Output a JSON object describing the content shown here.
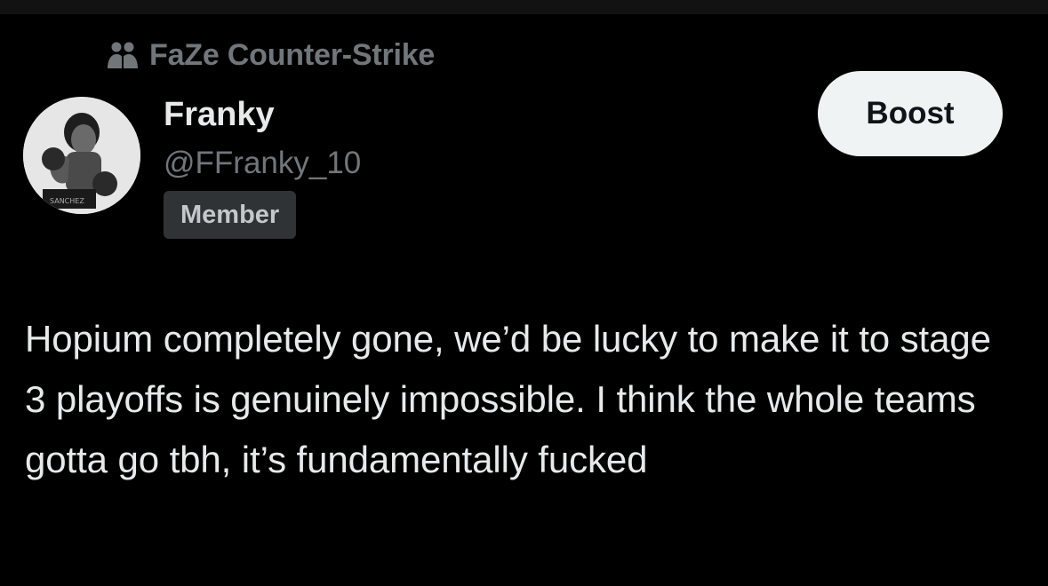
{
  "community": {
    "icon": "people-icon",
    "name": "FaZe Counter-Strike"
  },
  "author": {
    "display_name": "Franky",
    "handle": "@FFranky_10",
    "badge": "Member",
    "avatar_alt": "boxer-avatar"
  },
  "actions": {
    "boost_label": "Boost"
  },
  "post": {
    "text": "Hopium completely gone, we’d be lucky to make it to stage 3 playoffs is genuinely impossible. I think the whole teams gotta go tbh, it’s fundamentally fucked"
  },
  "colors": {
    "background": "#000000",
    "primary_text": "#e7e9ea",
    "secondary_text": "#71767b",
    "badge_bg": "#2f3336",
    "button_bg": "#eff3f4",
    "button_text": "#0f1419"
  }
}
